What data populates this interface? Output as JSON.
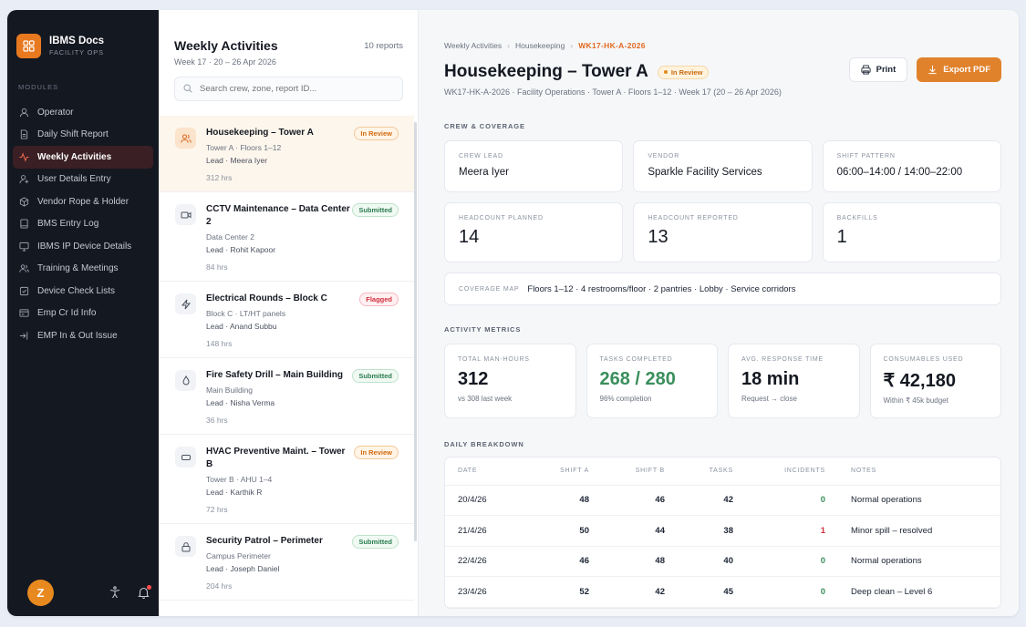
{
  "brand": {
    "name": "IBMS Docs",
    "sub": "FACILITY OPS",
    "accent": "#e8791f"
  },
  "sidebar": {
    "section": "MODULES",
    "items": [
      {
        "label": "Operator",
        "icon": "user-icon"
      },
      {
        "label": "Daily Shift Report",
        "icon": "document-icon"
      },
      {
        "label": "Weekly Activities",
        "icon": "activity-icon",
        "active": true
      },
      {
        "label": "User Details Entry",
        "icon": "user-add-icon"
      },
      {
        "label": "Vendor Rope & Holder",
        "icon": "box-icon"
      },
      {
        "label": "BMS Entry Log",
        "icon": "notebook-icon"
      },
      {
        "label": "IBMS IP Device Details",
        "icon": "monitor-icon"
      },
      {
        "label": "Training & Meetings",
        "icon": "users-icon"
      },
      {
        "label": "Device Check Lists",
        "icon": "checklist-icon"
      },
      {
        "label": "Emp Cr Id Info",
        "icon": "id-card-icon"
      },
      {
        "label": "EMP In & Out Issue",
        "icon": "login-icon"
      }
    ],
    "avatar": "Z"
  },
  "list": {
    "title": "Weekly Activities",
    "subtitle": "Week 17 · 20 – 26 Apr 2026",
    "count": "10 reports",
    "search_placeholder": "Search crew, zone, report ID...",
    "items": [
      {
        "title": "Housekeeping – Tower A",
        "badge": "In Review",
        "line1": "Tower A · Floors 1–12",
        "lead": "Lead · Meera Iyer",
        "hours": "312 hrs"
      },
      {
        "title": "CCTV Maintenance – Data Center 2",
        "badge": "Submitted",
        "line1": "Data Center 2",
        "lead": "Lead · Rohit Kapoor",
        "hours": "84 hrs"
      },
      {
        "title": "Electrical Rounds – Block C",
        "badge": "Flagged",
        "line1": "Block C · LT/HT panels",
        "lead": "Lead · Anand Subbu",
        "hours": "148 hrs"
      },
      {
        "title": "Fire Safety Drill – Main Building",
        "badge": "Submitted",
        "line1": "Main Building",
        "lead": "Lead · Nisha Verma",
        "hours": "36 hrs"
      },
      {
        "title": "HVAC Preventive Maint. – Tower B",
        "badge": "In Review",
        "line1": "Tower B · AHU 1–4",
        "lead": "Lead · Karthik R",
        "hours": "72 hrs"
      },
      {
        "title": "Security Patrol – Perimeter",
        "badge": "Submitted",
        "line1": "Campus Perimeter",
        "lead": "Lead · Joseph Daniel",
        "hours": "204 hrs"
      }
    ]
  },
  "detail": {
    "breadcrumb": [
      "Weekly Activities",
      "Housekeeping",
      "WK17-HK-A-2026"
    ],
    "title": "Housekeeping – Tower A",
    "status": "In Review",
    "print": "Print",
    "export": "Export PDF",
    "subline": "WK17-HK-A-2026 · Facility Operations · Tower A · Floors 1–12 · Week 17 (20 – 26 Apr 2026)",
    "crew_section": "CREW & COVERAGE",
    "crew": [
      {
        "label": "CREW LEAD",
        "value": "Meera Iyer"
      },
      {
        "label": "VENDOR",
        "value": "Sparkle Facility Services"
      },
      {
        "label": "SHIFT PATTERN",
        "value": "06:00–14:00 / 14:00–22:00"
      }
    ],
    "counts": [
      {
        "label": "HEADCOUNT PLANNED",
        "value": "14"
      },
      {
        "label": "HEADCOUNT REPORTED",
        "value": "13"
      },
      {
        "label": "BACKFILLS",
        "value": "1"
      }
    ],
    "coverage": {
      "label": "COVERAGE MAP",
      "value": "Floors 1–12 · 4 restrooms/floor · 2 pantries · Lobby · Service corridors"
    },
    "metrics_section": "ACTIVITY METRICS",
    "metrics": [
      {
        "label": "TOTAL MAN-HOURS",
        "value": "312",
        "sub": "vs 308 last week"
      },
      {
        "label": "TASKS COMPLETED",
        "value": "268 / 280",
        "sub": "96% completion"
      },
      {
        "label": "AVG. RESPONSE TIME",
        "value": "18 min",
        "sub": "Request → close"
      },
      {
        "label": "CONSUMABLES USED",
        "value": "₹ 42,180",
        "sub": "Within ₹ 45k budget"
      }
    ],
    "daily_section": "DAILY BREAKDOWN",
    "table": {
      "headers": [
        "DATE",
        "SHIFT A",
        "SHIFT B",
        "TASKS",
        "INCIDENTS",
        "NOTES"
      ],
      "rows": [
        [
          "20/4/26",
          "48",
          "46",
          "42",
          "0",
          "Normal operations"
        ],
        [
          "21/4/26",
          "50",
          "44",
          "38",
          "1",
          "Minor spill – resolved"
        ],
        [
          "22/4/26",
          "46",
          "48",
          "40",
          "0",
          "Normal operations"
        ],
        [
          "23/4/26",
          "52",
          "42",
          "45",
          "0",
          "Deep clean – Level 6"
        ]
      ]
    }
  }
}
